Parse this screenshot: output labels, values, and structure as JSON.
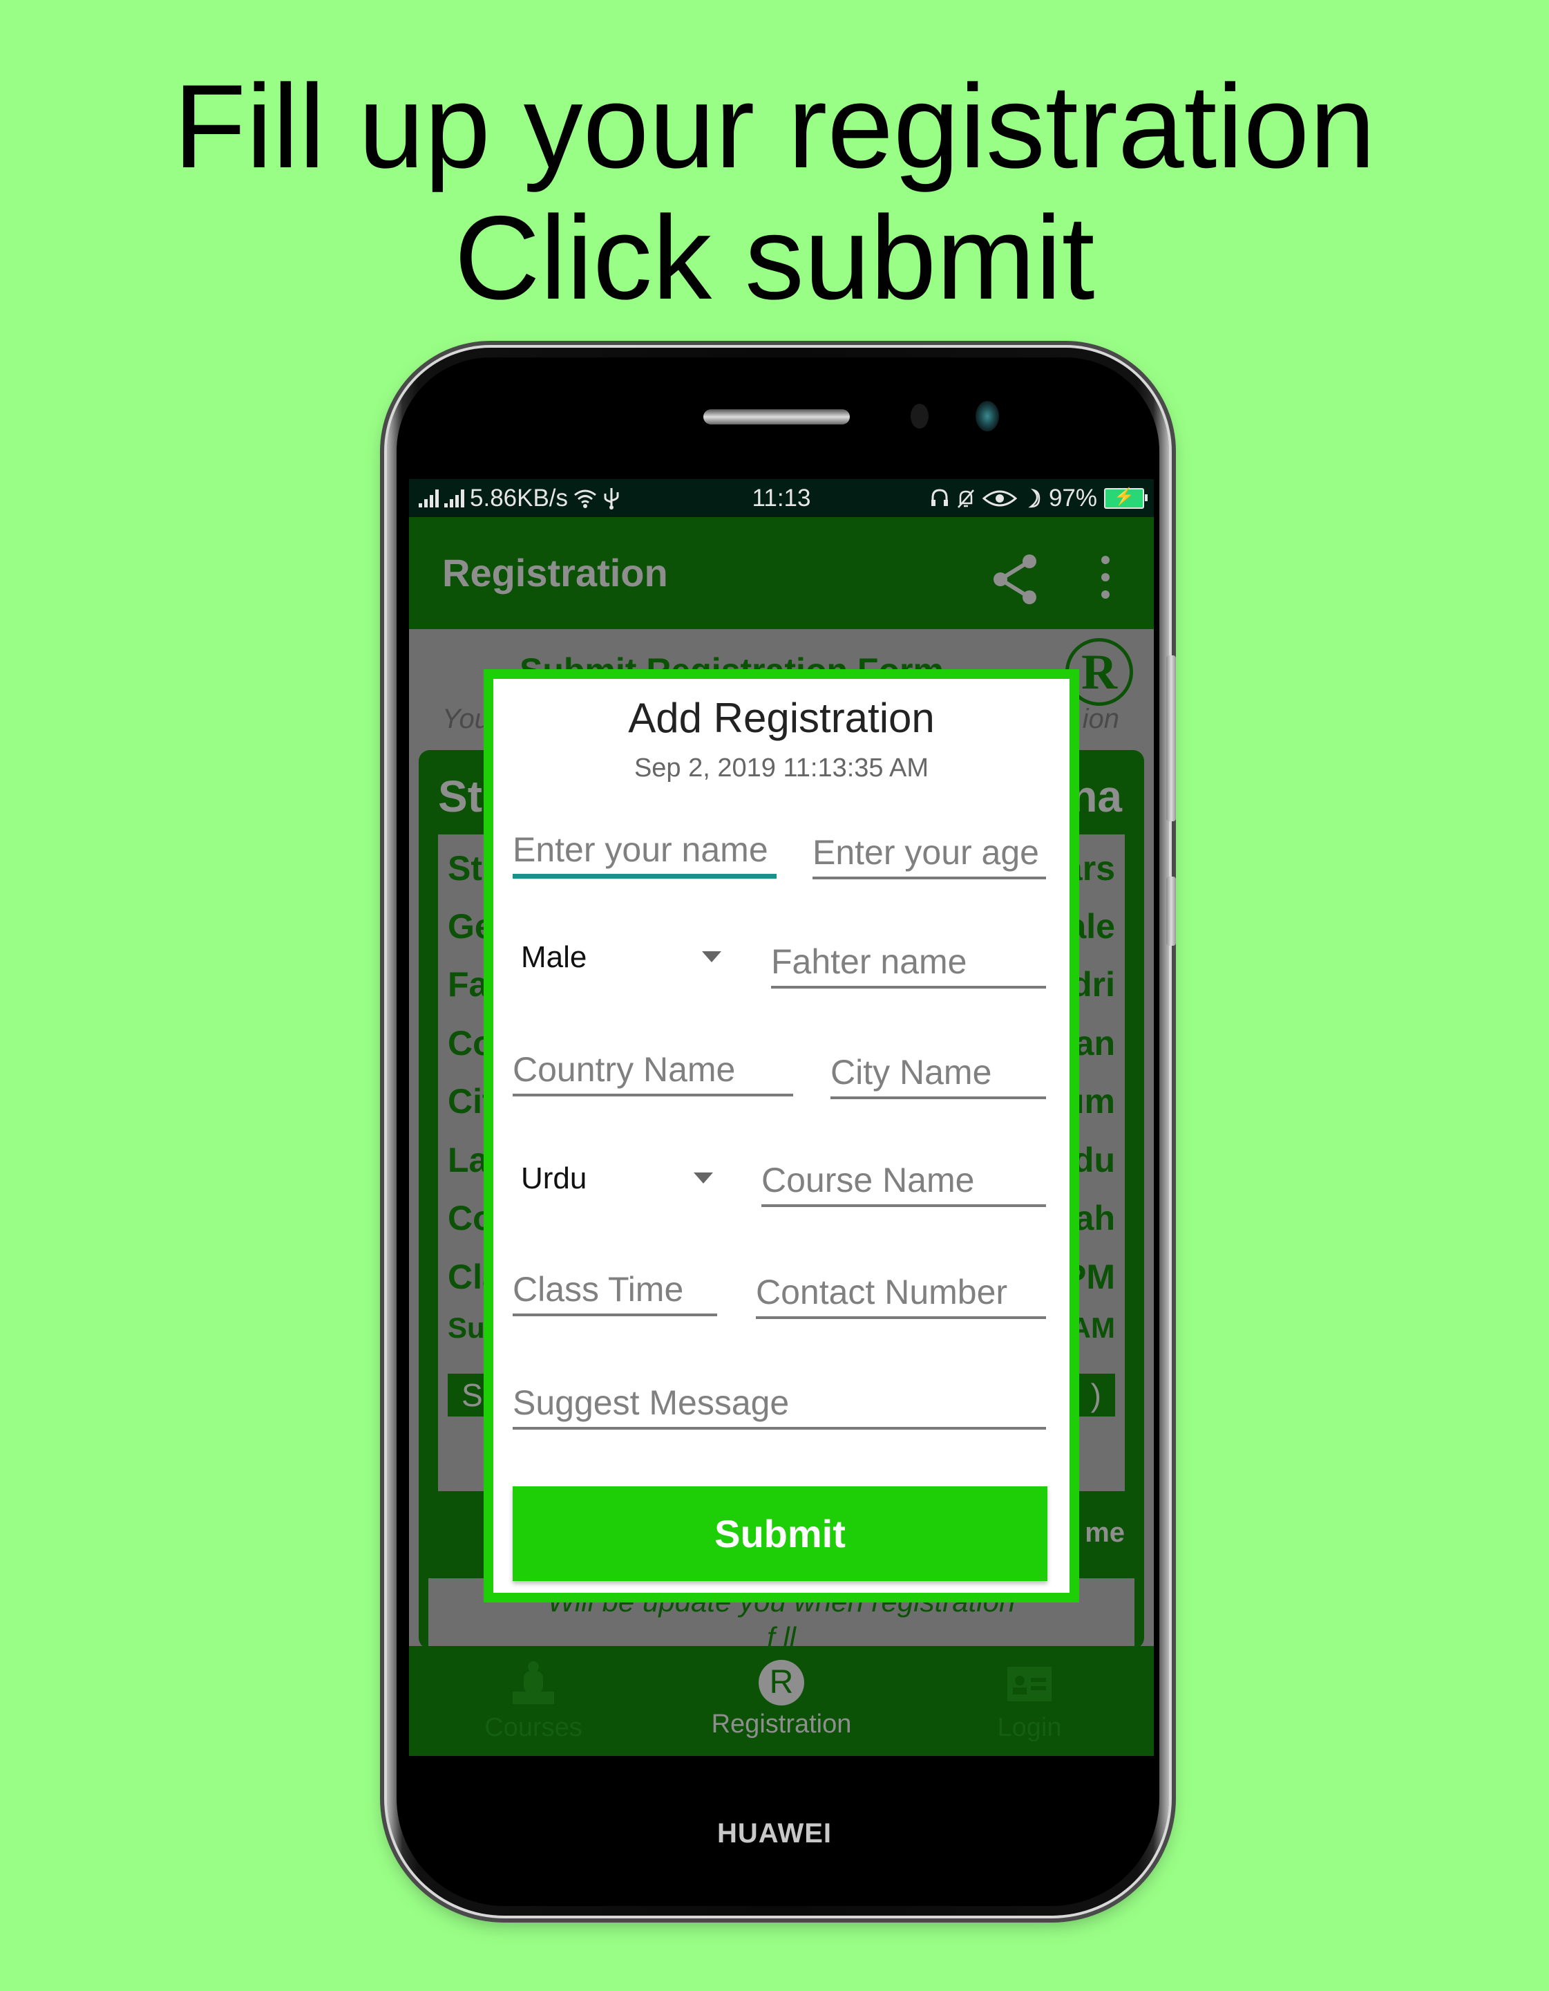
{
  "headline": {
    "line1": "Fill up your registration",
    "line2": "Click submit"
  },
  "device": {
    "brand": "HUAWEI"
  },
  "status_bar": {
    "network_speed": "5.86KB/s",
    "time": "11:13",
    "battery": "97%",
    "icons": [
      "signal-icon",
      "signal-icon",
      "wifi-icon",
      "usb-icon",
      "headset-icon",
      "bell-muted-icon",
      "eye-icon",
      "moon-icon",
      "battery-charging-icon"
    ]
  },
  "app_bar": {
    "title": "Registration",
    "actions": [
      "share-icon",
      "more-vert-icon"
    ]
  },
  "background_screen": {
    "heading": "Submit Registration Form",
    "subtitle_left": "You",
    "subtitle_right": "ion",
    "logo_letter": "R",
    "card_title_left": "St",
    "card_title_right": "na",
    "rows": [
      {
        "left": "Stu",
        "right": "ars"
      },
      {
        "left": "Ge",
        "right": "ale"
      },
      {
        "left": "Fat",
        "right": "dri"
      },
      {
        "left": "Co",
        "right": "tan"
      },
      {
        "left": "Cit",
        "right": "um"
      },
      {
        "left": "Lar",
        "right": "rdu"
      },
      {
        "left": "Co",
        "right": "lah"
      },
      {
        "left": "Cla",
        "right": "PM"
      },
      {
        "left": "Sul",
        "right": "AM"
      }
    ],
    "card_button_left": "S",
    "card_button_right": ")",
    "footer_right": "me",
    "note": "Will be update you when registration",
    "note_line2": "f ll"
  },
  "dialog": {
    "title": "Add Registration",
    "datetime": "Sep 2, 2019 11:13:35 AM",
    "name_placeholder": "Enter your name",
    "age_placeholder": "Enter your age",
    "gender_selected": "Male",
    "father_placeholder": "Fahter name",
    "country_placeholder": "Country Name",
    "city_placeholder": "City Name",
    "language_selected": "Urdu",
    "course_placeholder": "Course Name",
    "class_time_placeholder": "Class Time",
    "contact_placeholder": "Contact Number",
    "message_placeholder": "Suggest Message",
    "submit_label": "Submit"
  },
  "bottom_nav": {
    "items": [
      {
        "label": "Courses",
        "icon": "courses-icon",
        "active": false
      },
      {
        "label": "Registration",
        "icon": "registration-icon",
        "active": true
      },
      {
        "label": "Login",
        "icon": "login-card-icon",
        "active": false
      }
    ]
  },
  "colors": {
    "page_background": "#99fe86",
    "app_primary": "#0b5106",
    "accent_green": "#1ecf07",
    "focus_underline": "#16938a",
    "status_bar": "#021d13"
  }
}
